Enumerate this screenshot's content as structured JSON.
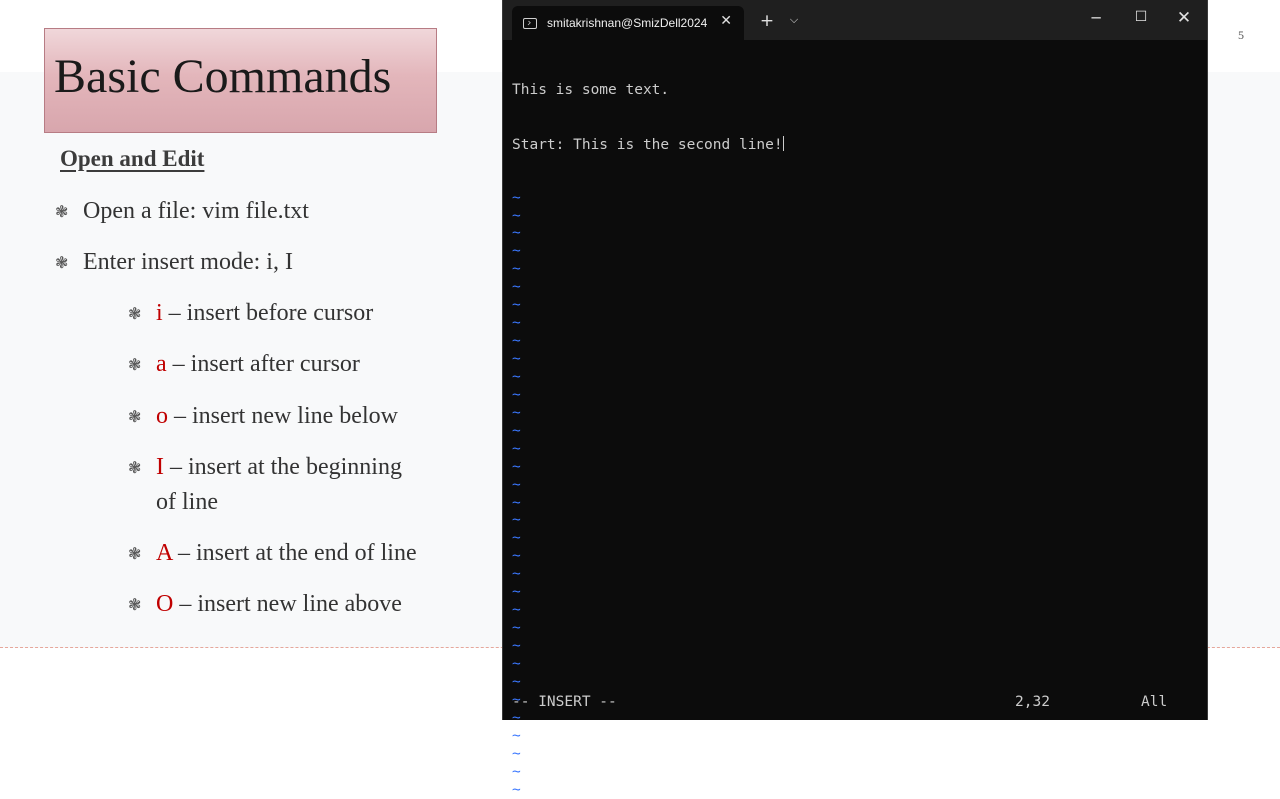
{
  "slide": {
    "title": "Basic Commands",
    "section_heading": "Open and Edit",
    "page_number": "5",
    "bullet_glyph": "❃",
    "bullets": [
      {
        "text": "Open a file: vim file.txt"
      },
      {
        "text": "Enter insert mode: i, I"
      }
    ],
    "sub_bullets": [
      {
        "key": "i",
        "text": " – insert before cursor"
      },
      {
        "key": "a",
        "text": " – insert after cursor"
      },
      {
        "key": "o",
        "text": " – insert new line below"
      },
      {
        "key": "I",
        "text": " – insert at the beginning",
        "text2": "of line"
      },
      {
        "key": "A",
        "text": " – insert at the end of line"
      },
      {
        "key": "O",
        "text": " – insert new line above"
      }
    ],
    "colors": {
      "key_highlight": "#c00000",
      "title_box": "#e3b6bb"
    }
  },
  "terminal": {
    "tab_title": "smitakrishnan@SmizDell2024",
    "icons": {
      "tab": "terminal-icon",
      "tab_close": "close-icon",
      "new_tab": "plus-icon",
      "dropdown": "chevron-down-icon",
      "minimize": "minimize-icon",
      "maximize": "maximize-icon",
      "close": "close-icon"
    },
    "lines": [
      "This is some text.",
      "Start: This is the second line!"
    ],
    "tilde_char": "~",
    "tilde_count": 34,
    "status": {
      "mode": "-- INSERT --",
      "position": "2,32",
      "scroll": "All"
    },
    "colors": {
      "background": "#0c0c0c",
      "text": "#cccccc",
      "tilde": "#3b78ff"
    }
  }
}
